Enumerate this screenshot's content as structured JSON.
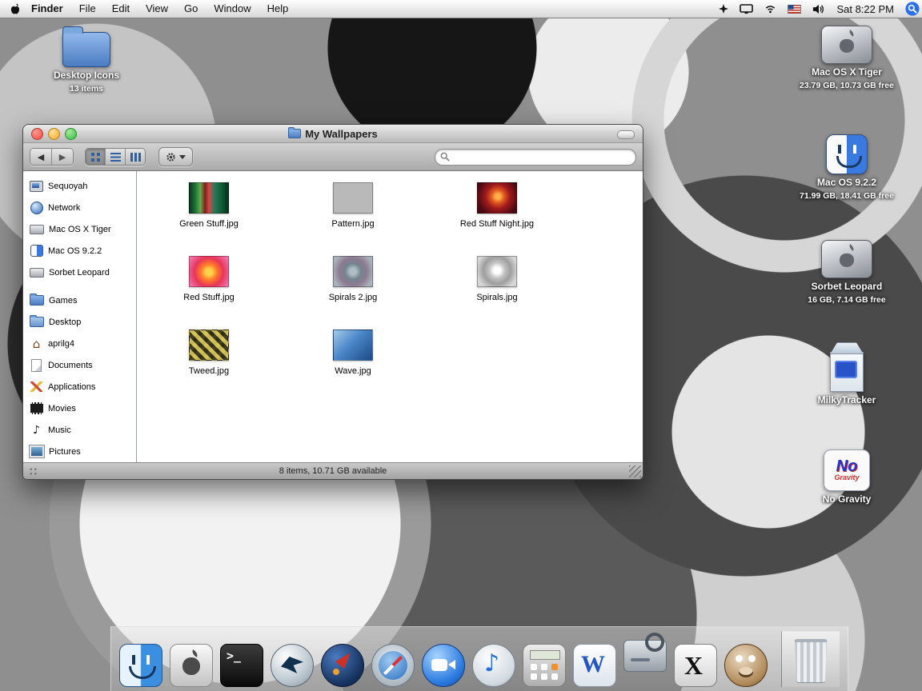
{
  "menu_bar": {
    "app_name": "Finder",
    "menus": [
      "File",
      "Edit",
      "View",
      "Go",
      "Window",
      "Help"
    ],
    "clock": "Sat 8:22 PM",
    "extras": [
      "sparkle-icon",
      "displays-icon",
      "airport-icon",
      "input-us-flag-icon",
      "volume-icon",
      "spotlight-icon"
    ]
  },
  "glyphs": {
    "back": "◀",
    "forward": "▶",
    "terminal": ">_",
    "word": "W",
    "x11": "X",
    "note": "♪",
    "home": "⌂"
  },
  "desktop": {
    "folder": {
      "label": "Desktop Icons",
      "sublabel": "13 items"
    },
    "volumes": [
      {
        "label": "Mac OS X Tiger",
        "sublabel": "23.79 GB, 10.73 GB free",
        "icon": "tiger-volume-icon"
      },
      {
        "label": "Mac OS 9.2.2",
        "sublabel": "71.99 GB, 18.41 GB free",
        "icon": "os9-volume-icon"
      },
      {
        "label": "Sorbet Leopard",
        "sublabel": "16 GB, 7.14 GB free",
        "icon": "leopard-volume-icon"
      }
    ],
    "apps": [
      {
        "label": "MilkyTracker",
        "icon": "milkytracker-icon"
      },
      {
        "label": "No Gravity",
        "icon": "no-gravity-icon",
        "icon_text": {
          "line1": "No",
          "line2": "Gravity"
        }
      }
    ]
  },
  "window": {
    "title": "My Wallpapers",
    "search_placeholder": "",
    "status": "8 items, 10.71 GB available",
    "sidebar_devices": [
      {
        "label": "Sequoyah",
        "icon": "computer-icon"
      },
      {
        "label": "Network",
        "icon": "network-globe-icon"
      },
      {
        "label": "Mac OS X Tiger",
        "icon": "drive-icon"
      },
      {
        "label": "Mac OS 9.2.2",
        "icon": "classic-mac-icon"
      },
      {
        "label": "Sorbet Leopard",
        "icon": "drive-icon"
      }
    ],
    "sidebar_places": [
      {
        "label": "Games",
        "icon": "folder-icon"
      },
      {
        "label": "Desktop",
        "icon": "desktop-folder-icon"
      },
      {
        "label": "aprilg4",
        "icon": "home-icon"
      },
      {
        "label": "Documents",
        "icon": "document-icon"
      },
      {
        "label": "Applications",
        "icon": "applications-icon"
      },
      {
        "label": "Movies",
        "icon": "movies-icon"
      },
      {
        "label": "Music",
        "icon": "music-note-icon"
      },
      {
        "label": "Pictures",
        "icon": "pictures-icon"
      }
    ],
    "files": [
      {
        "label": "Green Stuff.jpg"
      },
      {
        "label": "Pattern.jpg"
      },
      {
        "label": "Red Stuff Night.jpg"
      },
      {
        "label": "Red Stuff.jpg"
      },
      {
        "label": "Spirals 2.jpg"
      },
      {
        "label": "Spirals.jpg"
      },
      {
        "label": "Tweed.jpg"
      },
      {
        "label": "Wave.jpg"
      }
    ]
  },
  "dock": {
    "icons": [
      "finder-icon",
      "apple-box-icon",
      "terminal-icon",
      "camino-icon",
      "mozilla-icon",
      "safari-icon",
      "ichat-icon",
      "itunes-icon",
      "calculator-icon",
      "word-icon",
      "disk-utility-icon",
      "x11-icon",
      "gimp-icon"
    ],
    "trash": "trash-icon"
  }
}
